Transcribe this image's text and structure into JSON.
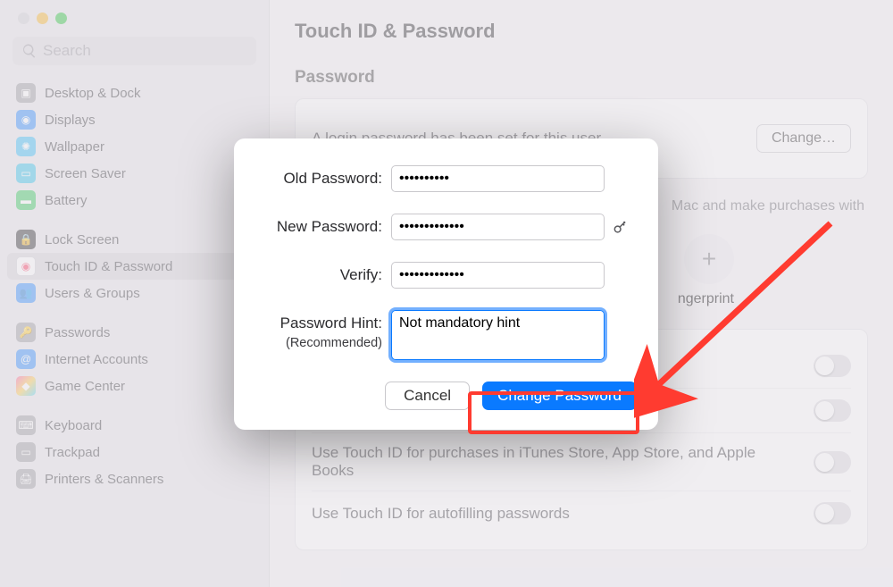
{
  "search": {
    "placeholder": "Search"
  },
  "sidebar": {
    "groups": [
      [
        {
          "label": "Desktop & Dock"
        },
        {
          "label": "Displays"
        },
        {
          "label": "Wallpaper"
        },
        {
          "label": "Screen Saver"
        },
        {
          "label": "Battery"
        }
      ],
      [
        {
          "label": "Lock Screen"
        },
        {
          "label": "Touch ID & Password"
        },
        {
          "label": "Users & Groups"
        }
      ],
      [
        {
          "label": "Passwords"
        },
        {
          "label": "Internet Accounts"
        },
        {
          "label": "Game Center"
        }
      ],
      [
        {
          "label": "Keyboard"
        },
        {
          "label": "Trackpad"
        },
        {
          "label": "Printers & Scanners"
        }
      ]
    ]
  },
  "content": {
    "title": "Touch ID & Password",
    "password_section": "Password",
    "password_set_msg": "A login password has been set for this user",
    "change_btn": "Change…",
    "touchid_desc_prefix": "Mac and make purchases with",
    "add_fingerprint": "ngerprint",
    "toggles": [
      {
        "label": ""
      },
      {
        "label": ""
      },
      {
        "label": "Use Touch ID for purchases in iTunes Store, App Store, and Apple Books"
      },
      {
        "label": "Use Touch ID for autofilling passwords"
      }
    ]
  },
  "dialog": {
    "old_label": "Old Password:",
    "old_value": "••••••••••",
    "new_label": "New Password:",
    "new_value": "•••••••••••••",
    "verify_label": "Verify:",
    "verify_value": "•••••••••••••",
    "hint_label": "Password Hint:",
    "hint_sub": "(Recommended)",
    "hint_value": "Not mandatory hint",
    "cancel": "Cancel",
    "change": "Change Password"
  },
  "icons": {
    "search": "search-icon",
    "key": "key-icon"
  }
}
